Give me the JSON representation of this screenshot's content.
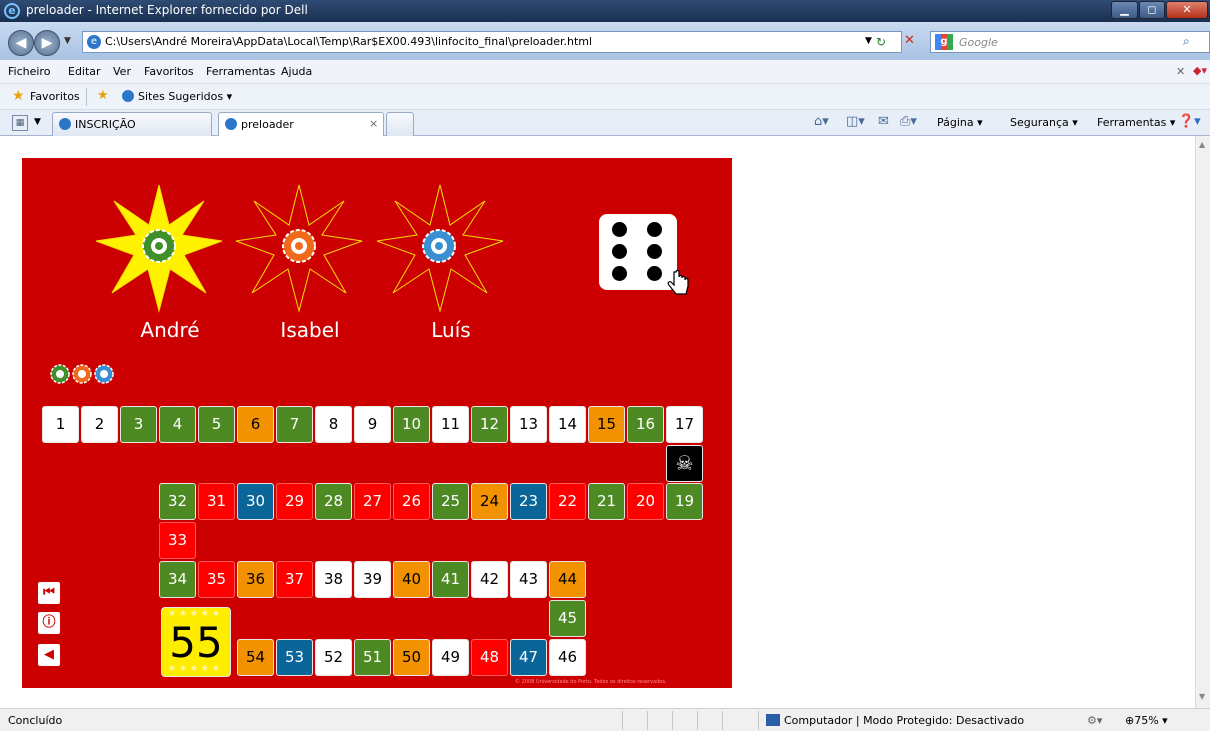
{
  "window": {
    "title": "preloader - Internet Explorer fornecido por Dell",
    "url": "C:\\Users\\André Moreira\\AppData\\Local\\Temp\\Rar$EX00.493\\linfocito_final\\preloader.html",
    "search_placeholder": "Google"
  },
  "menu": [
    "Ficheiro",
    "Editar",
    "Ver",
    "Favoritos",
    "Ferramentas",
    "Ajuda"
  ],
  "favorites": {
    "label": "Favoritos",
    "sites": "Sites Sugeridos ▾"
  },
  "tabs": [
    {
      "label": "INSCRIÇÃO"
    },
    {
      "label": "preloader",
      "close": "×"
    }
  ],
  "commands": [
    "Página ▾",
    "Segurança ▾",
    "Ferramentas ▾"
  ],
  "status": {
    "text": "Concluído",
    "zone": "Computador | Modo Protegido: Desactivado",
    "zoom": "75%"
  },
  "game": {
    "players": [
      {
        "name": "André",
        "color": "#3f8f2a",
        "active": true
      },
      {
        "name": "Isabel",
        "color": "#f06a1a",
        "active": false
      },
      {
        "name": "Luís",
        "color": "#3a8fd0",
        "active": false
      }
    ],
    "die_value": 6,
    "finish_number": "55",
    "skull_icon": "☠",
    "copyright": "© 2008 Universidade do Porto. Todos os direitos reservados.",
    "side_buttons": [
      {
        "name": "restart",
        "icon": "⏮"
      },
      {
        "name": "info",
        "icon": "ⓘ"
      },
      {
        "name": "sound",
        "icon": "◀"
      }
    ],
    "tiles": [
      {
        "n": "1",
        "c": "w"
      },
      {
        "n": "2",
        "c": "w"
      },
      {
        "n": "3",
        "c": "g"
      },
      {
        "n": "4",
        "c": "g"
      },
      {
        "n": "5",
        "c": "g"
      },
      {
        "n": "6",
        "c": "o"
      },
      {
        "n": "7",
        "c": "g"
      },
      {
        "n": "8",
        "c": "w"
      },
      {
        "n": "9",
        "c": "w"
      },
      {
        "n": "10",
        "c": "g"
      },
      {
        "n": "11",
        "c": "w"
      },
      {
        "n": "12",
        "c": "g"
      },
      {
        "n": "13",
        "c": "w"
      },
      {
        "n": "14",
        "c": "w"
      },
      {
        "n": "15",
        "c": "o"
      },
      {
        "n": "16",
        "c": "g"
      },
      {
        "n": "17",
        "c": "w"
      },
      {
        "n": "☠",
        "c": "k"
      },
      {
        "n": "19",
        "c": "g"
      },
      {
        "n": "20",
        "c": "r"
      },
      {
        "n": "21",
        "c": "g"
      },
      {
        "n": "22",
        "c": "r"
      },
      {
        "n": "23",
        "c": "b"
      },
      {
        "n": "24",
        "c": "o"
      },
      {
        "n": "25",
        "c": "g"
      },
      {
        "n": "26",
        "c": "r"
      },
      {
        "n": "27",
        "c": "r"
      },
      {
        "n": "28",
        "c": "g"
      },
      {
        "n": "29",
        "c": "r"
      },
      {
        "n": "30",
        "c": "b"
      },
      {
        "n": "31",
        "c": "r"
      },
      {
        "n": "32",
        "c": "g"
      },
      {
        "n": "33",
        "c": "r"
      },
      {
        "n": "34",
        "c": "g"
      },
      {
        "n": "35",
        "c": "r"
      },
      {
        "n": "36",
        "c": "o"
      },
      {
        "n": "37",
        "c": "r"
      },
      {
        "n": "38",
        "c": "w"
      },
      {
        "n": "39",
        "c": "w"
      },
      {
        "n": "40",
        "c": "o"
      },
      {
        "n": "41",
        "c": "g"
      },
      {
        "n": "42",
        "c": "w"
      },
      {
        "n": "43",
        "c": "w"
      },
      {
        "n": "44",
        "c": "o"
      },
      {
        "n": "45",
        "c": "g"
      },
      {
        "n": "46",
        "c": "w"
      },
      {
        "n": "47",
        "c": "b"
      },
      {
        "n": "48",
        "c": "r"
      },
      {
        "n": "49",
        "c": "w"
      },
      {
        "n": "50",
        "c": "o"
      },
      {
        "n": "51",
        "c": "g"
      },
      {
        "n": "52",
        "c": "w"
      },
      {
        "n": "53",
        "c": "b"
      },
      {
        "n": "54",
        "c": "o"
      }
    ]
  }
}
